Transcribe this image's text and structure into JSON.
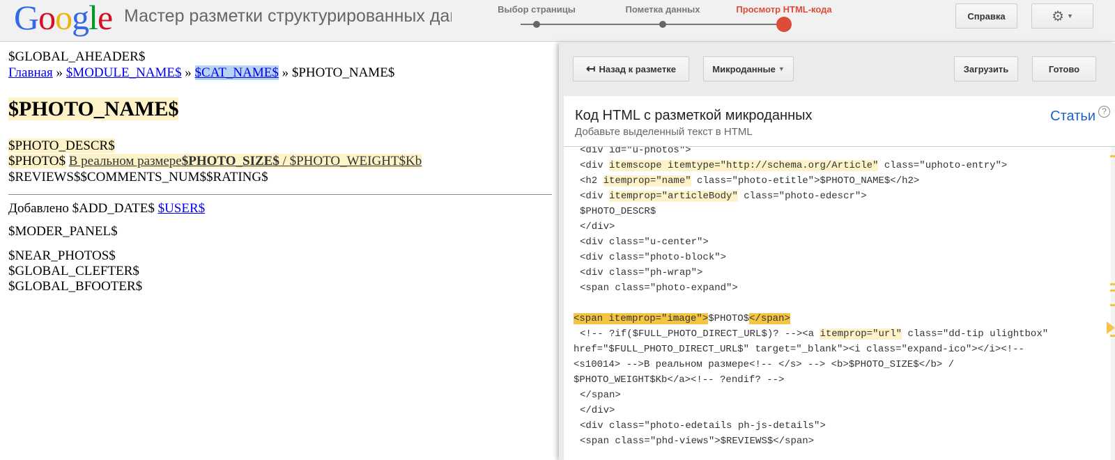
{
  "header": {
    "logo_letters": [
      "G",
      "o",
      "o",
      "g",
      "l",
      "e"
    ],
    "title": "Мастер разметки структурированных данных",
    "steps": [
      {
        "label": "Выбор страницы"
      },
      {
        "label": "Пометка данных"
      },
      {
        "label": "Просмотр HTML-кода"
      }
    ],
    "help_label": "Справка",
    "gear_icon": "gear-icon"
  },
  "preview": {
    "global_header": "$GLOBAL_AHEADER$",
    "breadcrumb": {
      "home": "Главная",
      "sep": "»",
      "module": "$MODULE_NAME$",
      "category": "$CAT_NAME$",
      "photo": "$PHOTO_NAME$"
    },
    "photo_name": "$PHOTO_NAME$",
    "photo_descr": "$PHOTO_DESCR$",
    "photo_placeholder": "$PHOTO$",
    "full_size_text": "В реальном размере",
    "photo_size": "$PHOTO_SIZE$",
    "size_sep": " / ",
    "photo_weight": "$PHOTO_WEIGHT$Kb",
    "stats": "$REVIEWS$$COMMENTS_NUM$$RATING$",
    "added_label": "Добавлено $ADD_DATE$",
    "user": "$USER$",
    "moder_panel": "$MODER_PANEL$",
    "near_photos": "$NEAR_PHOTOS$",
    "global_clefter": "$GLOBAL_CLEFTER$",
    "global_bfooter": "$GLOBAL_BFOOTER$"
  },
  "toolbar": {
    "back_label": "Назад к разметке",
    "format_label": "Микроданные",
    "upload_label": "Загрузить",
    "done_label": "Готово"
  },
  "code_panel": {
    "title": "Код HTML с разметкой микроданных",
    "subtitle": "Добавьте выделенный текст в HTML",
    "articles_link": "Статьи",
    "help_glyph": "?",
    "lines": {
      "l1": "<div id=\"u-photos\">",
      "l2a": "<div ",
      "l2b": "itemscope itemtype=\"http://schema.org/Article\"",
      "l2c": " class=\"uphoto-entry\">",
      "l3a": "<h2 ",
      "l3b": "itemprop=\"name\"",
      "l3c": " class=\"photo-etitle\">$PHOTO_NAME$</h2>",
      "l4a": "<div ",
      "l4b": "itemprop=\"articleBody\"",
      "l4c": " class=\"photo-edescr\">",
      "l5": "$PHOTO_DESCR$",
      "l6": "</div>",
      "l7": "<div class=\"u-center\">",
      "l8": "<div class=\"photo-block\">",
      "l9": "<div class=\"ph-wrap\">",
      "l10": "<span class=\"photo-expand\">",
      "l11a": "<span itemprop=\"image\">",
      "l11b": "$PHOTO$",
      "l11c": "</span>",
      "l12a": "<!-- ?if($FULL_PHOTO_DIRECT_URL$)? --><a ",
      "l12b": "itemprop=\"url\"",
      "l12c": " class=\"dd-tip ulightbox\"",
      "l13": "href=\"$FULL_PHOTO_DIRECT_URL$\" target=\"_blank\"><i class=\"expand-ico\"></i><!--",
      "l14": "<s10014> -->В реальном размере<!-- </s> --> <b>$PHOTO_SIZE$</b> /",
      "l15": "$PHOTO_WEIGHT$Kb</a><!-- ?endif? -->",
      "l16": "</span>",
      "l17": "</div>",
      "l18": "<div class=\"photo-edetails ph-js-details\">",
      "l19": "<span class=\"phd-views\">$REVIEWS$</span>"
    }
  },
  "colors": {
    "accent_red": "#dd4b39",
    "highlight_light": "#fdf2c8",
    "highlight_strong": "#f5c443",
    "link_blue": "#1a62c5"
  }
}
